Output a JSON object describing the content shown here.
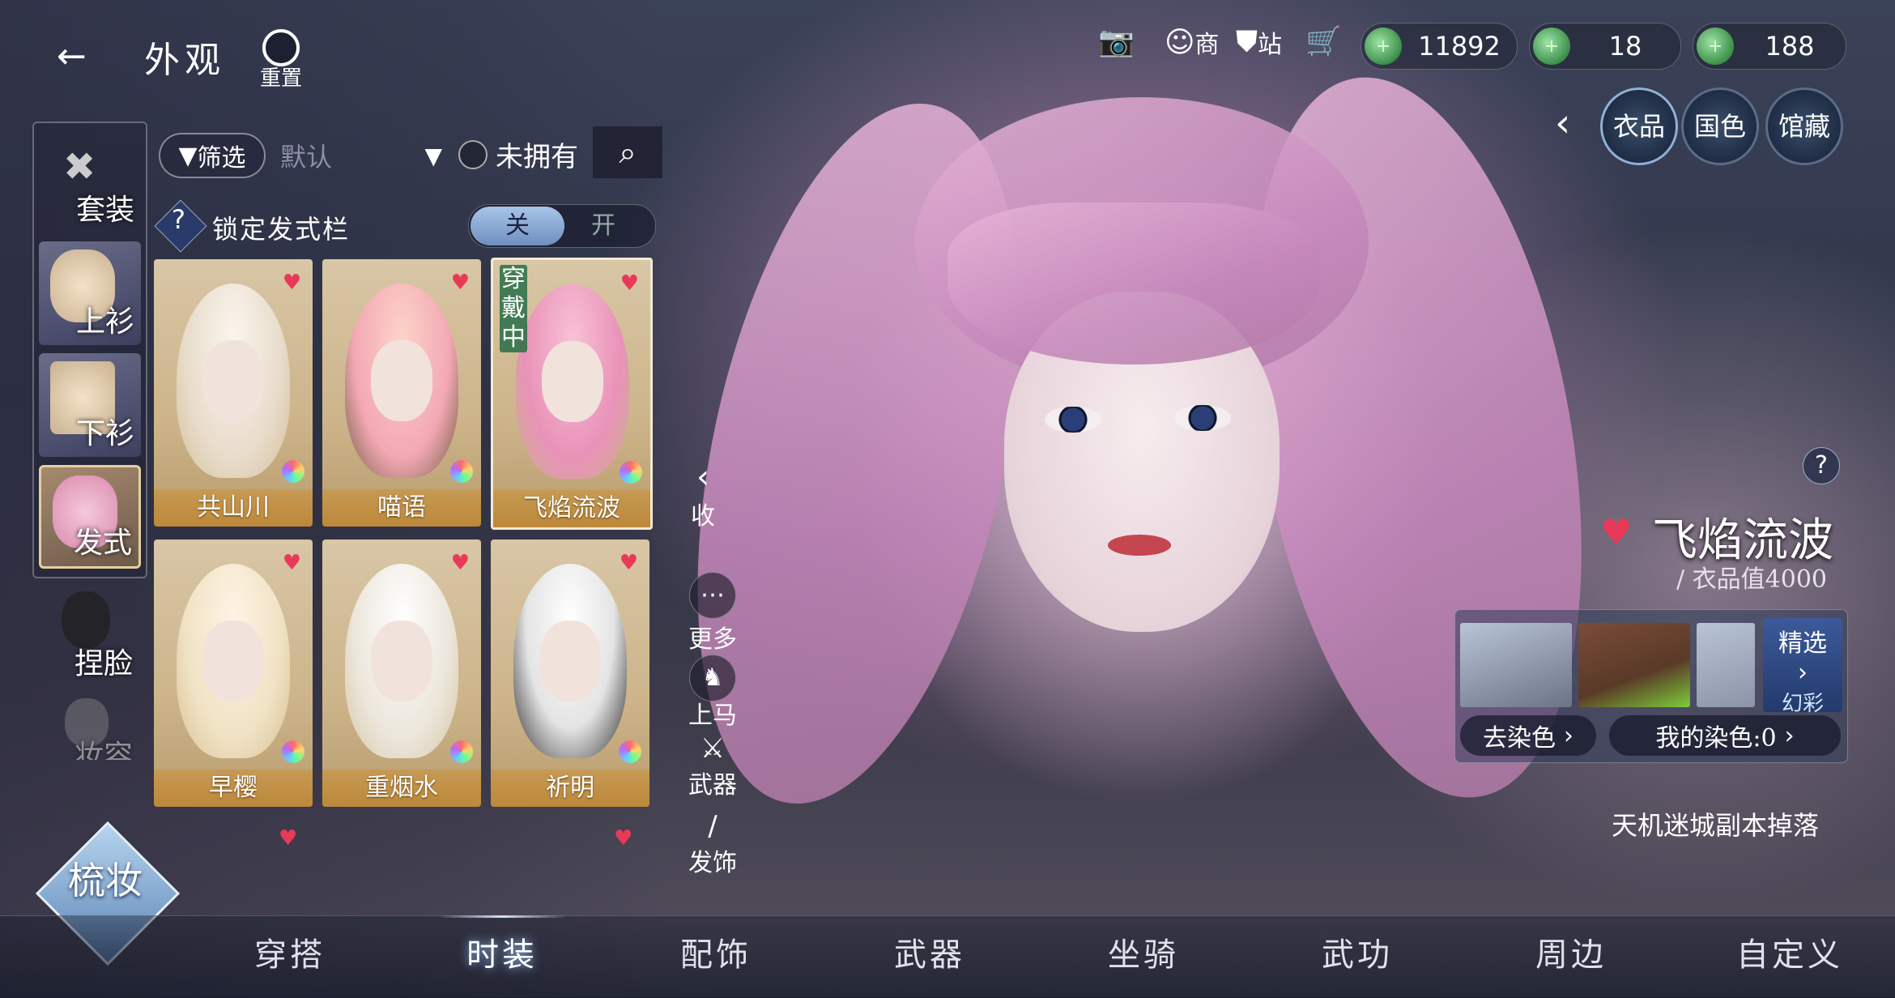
{
  "header": {
    "title": "外观",
    "reset_label": "重置",
    "shop_label": "商",
    "station_label": "站",
    "currencies": [
      {
        "name": "jade-coin-icon",
        "value": "11892"
      },
      {
        "name": "green-coin-icon",
        "value": "18"
      },
      {
        "name": "bag-coin-icon",
        "value": "188"
      }
    ]
  },
  "categories": [
    {
      "label": "套装"
    },
    {
      "label": "上衫"
    },
    {
      "label": "下衫"
    },
    {
      "label": "发式"
    },
    {
      "label": "捏脸"
    },
    {
      "label": "妆容"
    }
  ],
  "filter": {
    "filter_label": "筛选",
    "sort_value": "默认",
    "unowned_label": "未拥有",
    "lock_label": "锁定发式栏",
    "toggle_off": "关",
    "toggle_on": "开"
  },
  "items": [
    {
      "name": "共山川",
      "wearing": false
    },
    {
      "name": "喵语",
      "wearing": false
    },
    {
      "name": "飞焰流波",
      "wearing": true,
      "wearing_label": "穿戴中"
    },
    {
      "name": "早樱",
      "wearing": false
    },
    {
      "name": "重烟水",
      "wearing": false
    },
    {
      "name": "祈明",
      "wearing": false
    }
  ],
  "side_actions": {
    "collapse": "收",
    "more": "更多",
    "mount": "上马",
    "weapon": "武器",
    "hair_accessory": "发饰"
  },
  "mode_badge": "梳妆",
  "right_tabs": [
    "衣品",
    "国色",
    "馆藏"
  ],
  "detail": {
    "item_name": "飞焰流波",
    "style_value": "/ 衣品值4000",
    "featured_label": "精选",
    "iridescent_label": "幻彩",
    "dye_label": "去染色",
    "my_dye_label": "我的染色:0",
    "source": "天机迷城副本掉落"
  },
  "bottom_nav": [
    "穿搭",
    "时装",
    "配饰",
    "武器",
    "坐骑",
    "武功",
    "周边",
    "自定义"
  ],
  "bottom_nav_active": "时装",
  "colors": {
    "accent_blue": "#8fb1d8",
    "card_gold": "#c8a060",
    "heart_red": "#e83a58",
    "wearing_green": "#286e46"
  }
}
